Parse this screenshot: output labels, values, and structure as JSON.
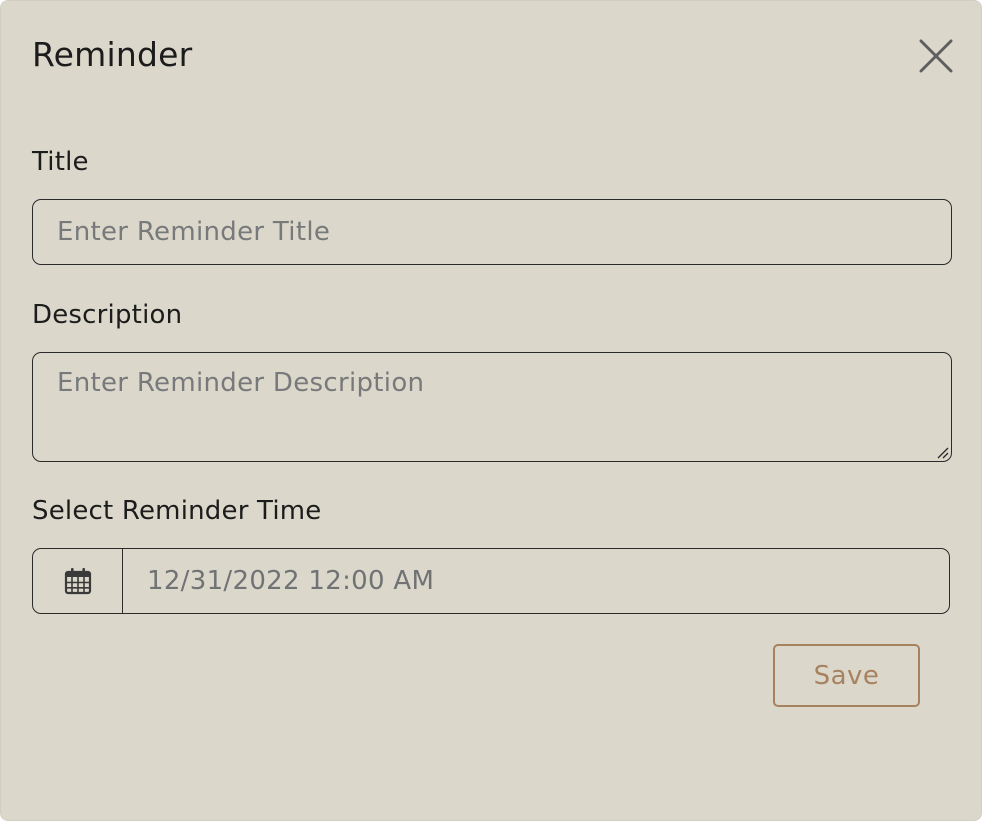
{
  "dialog": {
    "title": "Reminder",
    "close_icon": "close-icon"
  },
  "form": {
    "title_label": "Title",
    "title_placeholder": "Enter Reminder Title",
    "title_value": "",
    "description_label": "Description",
    "description_placeholder": "Enter Reminder Description",
    "description_value": "",
    "time_label": "Select Reminder Time",
    "time_icon": "calendar-icon",
    "time_value": "12/31/2022 12:00 AM",
    "save_label": "Save"
  },
  "colors": {
    "dialog_background": "#dbd8cb",
    "text": "#1c1c1c",
    "placeholder": "#77797b",
    "border": "#2b2b2b",
    "accent": "#a68261"
  }
}
